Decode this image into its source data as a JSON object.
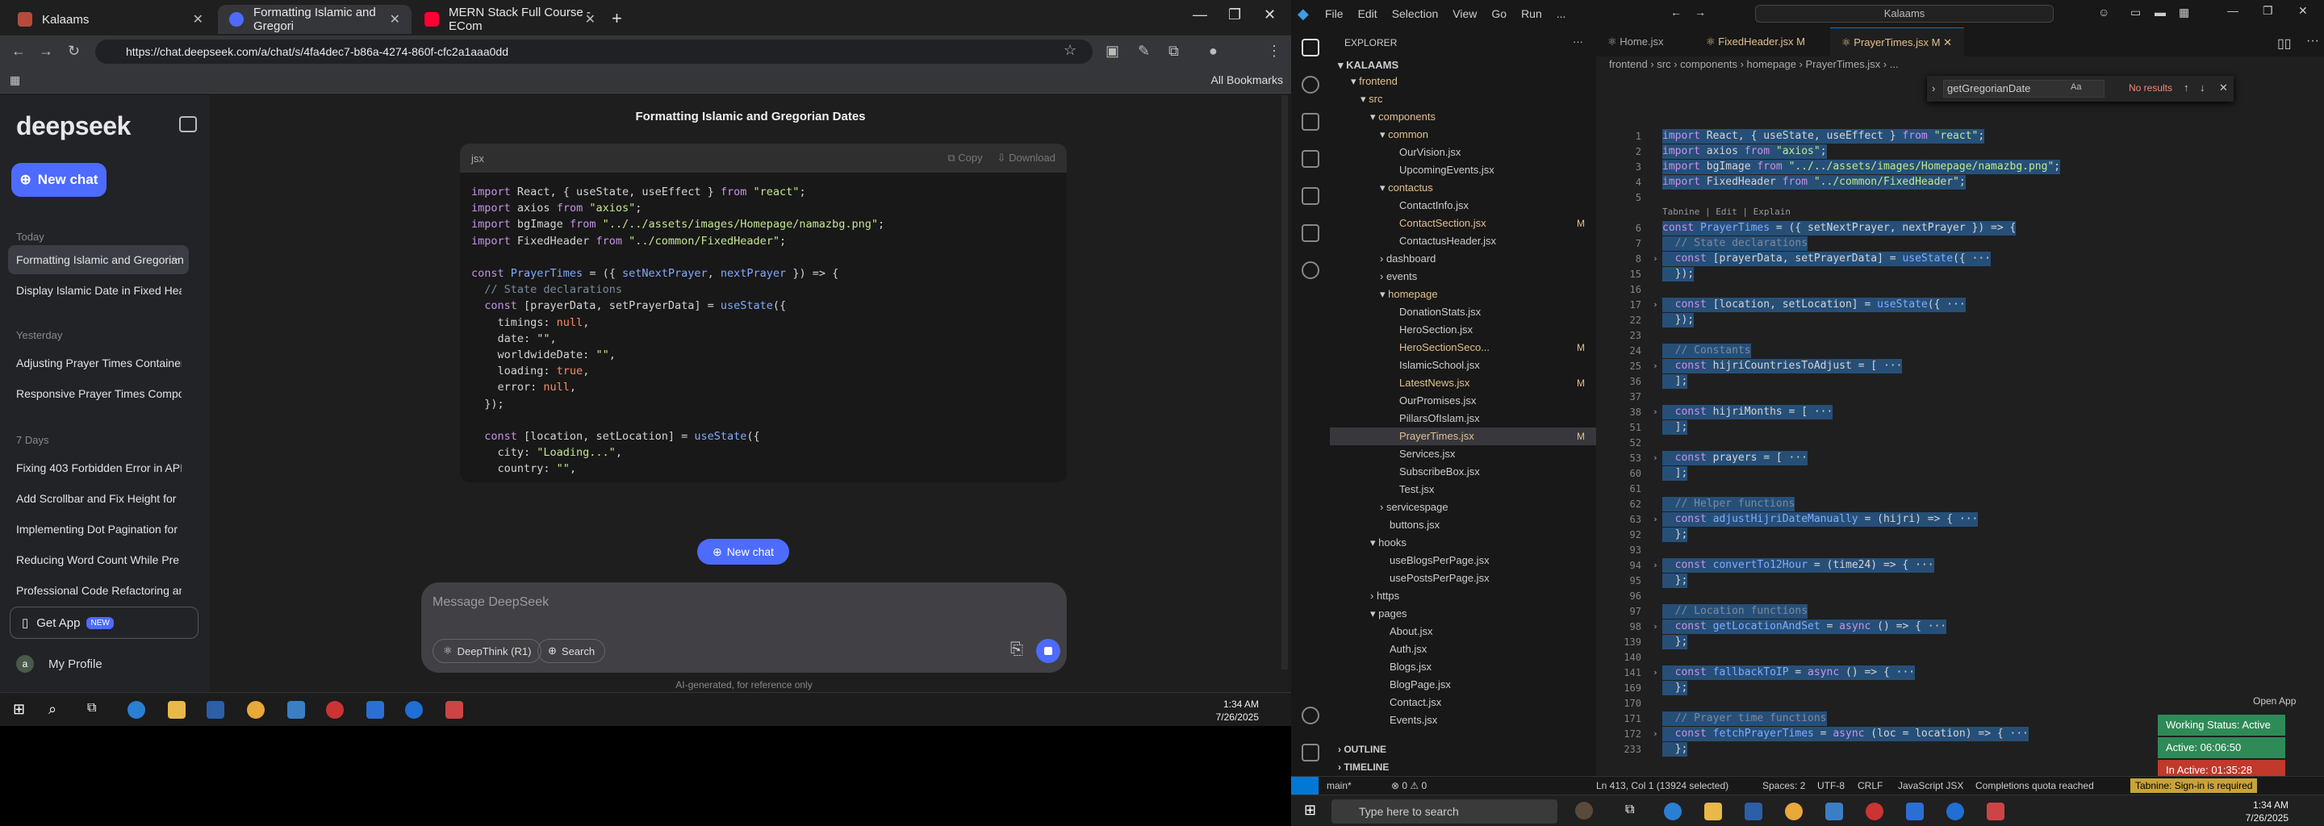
{
  "browser": {
    "tabs": [
      {
        "label": "Kalaams",
        "color": "#b84a3a"
      },
      {
        "label": "Formatting Islamic and Gregori",
        "color": "#4d6bfe"
      },
      {
        "label": "MERN Stack Full Course - ECom",
        "color": "#ff0033"
      }
    ],
    "url": "https://chat.deepseek.com/a/chat/s/4fa4dec7-b86a-4274-860f-cfc2a1aaa0dd",
    "all_bookmarks": "All Bookmarks"
  },
  "sidebar": {
    "logo": "deepseek",
    "new_chat": "New chat",
    "sections": [
      {
        "label": "Today",
        "items": [
          "Formatting Islamic and Gregorian",
          "Display Islamic Date in Fixed Head"
        ]
      },
      {
        "label": "Yesterday",
        "items": [
          "Adjusting Prayer Times Container",
          "Responsive Prayer Times Compo"
        ]
      },
      {
        "label": "7 Days",
        "items": [
          "Fixing 403 Forbidden Error in API",
          "Add Scrollbar and Fix Height for",
          "Implementing Dot Pagination for",
          "Reducing Word Count While Pre",
          "Professional Code Refactoring an"
        ]
      }
    ],
    "get_app": "Get App",
    "get_app_badge": "NEW",
    "profile": "My Profile"
  },
  "chat": {
    "title": "Formatting Islamic and Gregorian Dates",
    "code_lang": "jsx",
    "copy": "Copy",
    "download": "Download",
    "new_chat_button": "New chat",
    "composer_placeholder": "Message DeepSeek",
    "deepthink": "DeepThink (R1)",
    "search": "Search",
    "disclaimer": "AI-generated, for reference only"
  },
  "taskbar_left": {
    "time": "1:34 AM",
    "date": "7/26/2025"
  },
  "vscode": {
    "menu": [
      "File",
      "Edit",
      "Selection",
      "View",
      "Go",
      "Run",
      "..."
    ],
    "search": "Kalaams",
    "explorer_title": "EXPLORER",
    "workspace": "KALAAMS",
    "tabs": [
      {
        "label": "Home.jsx",
        "mod": ""
      },
      {
        "label": "FixedHeader.jsx",
        "mod": "M"
      },
      {
        "label": "PrayerTimes.jsx",
        "mod": "M"
      }
    ],
    "breadcrumb": "frontend › src › components › homepage › PrayerTimes.jsx › ...",
    "find_value": "getGregorianDate",
    "find_result": "No results",
    "outline": "OUTLINE",
    "timeline": "TIMELINE",
    "status": {
      "branch": "main*",
      "problems": "⊗ 0 ⚠ 0",
      "cursor": "Ln 413, Col 1 (13924 selected)",
      "spaces": "Spaces: 2",
      "encoding": "UTF-8",
      "eol": "CRLF",
      "lang": "JavaScript JSX",
      "quota": "Completions quota reached",
      "tabnine": "Tabnine: Sign-in is required"
    },
    "work_status": {
      "open_app": "Open App",
      "working": "Working Status: Active",
      "active": "Active: 06:06:50",
      "inactive": "In Active: 01:35:28"
    }
  },
  "taskbar_right": {
    "search": "Type here to search",
    "time": "1:34 AM",
    "date": "7/26/2025"
  }
}
